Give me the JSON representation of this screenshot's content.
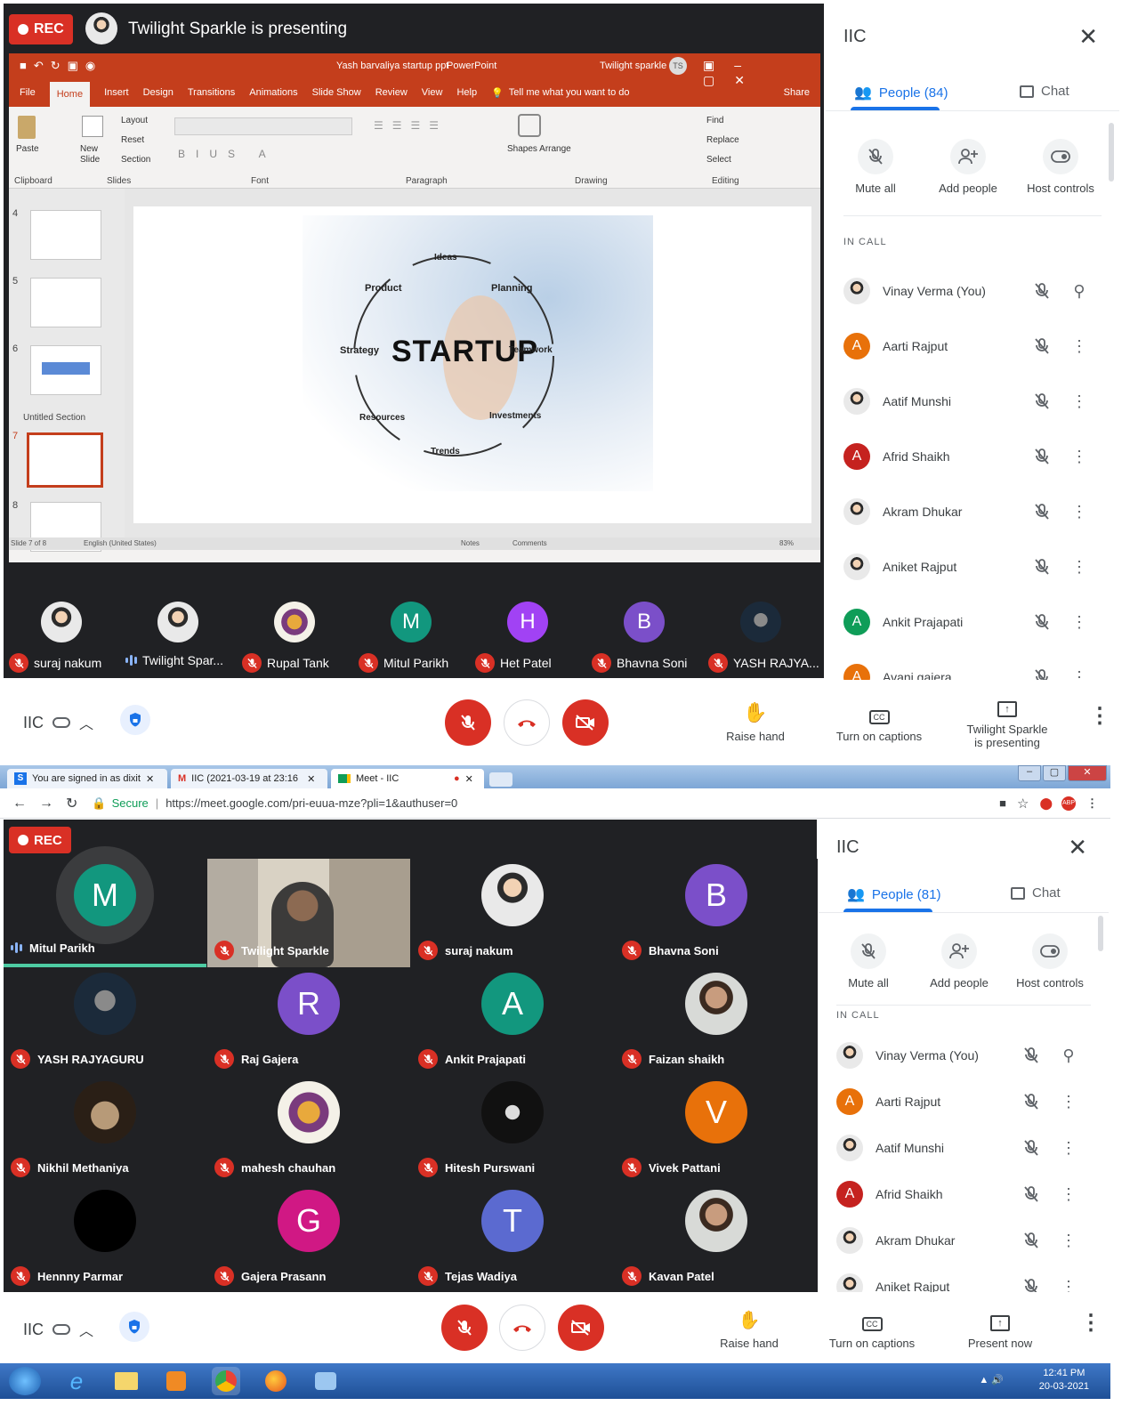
{
  "colors": {
    "accent": "#1a73e8",
    "danger": "#d93025",
    "stage": "#202124"
  },
  "top": {
    "rec": "REC",
    "presenting_banner": "Twilight Sparkle is presenting",
    "ppt": {
      "doc_title": "Yash barvaliya startup ppt",
      "app": "PowerPoint",
      "user": "Twilight sparkle",
      "user_initials": "TS",
      "tabs": [
        "File",
        "Home",
        "Insert",
        "Design",
        "Transitions",
        "Animations",
        "Slide Show",
        "Review",
        "View",
        "Help"
      ],
      "tell_me": "Tell me what you want to do",
      "share": "Share",
      "ribbon": {
        "paste": "Paste",
        "new_slide": "New Slide",
        "layout": "Layout",
        "reset": "Reset",
        "section": "Section",
        "shapes_arrange": "Shapes Arrange",
        "find": "Find",
        "replace": "Replace",
        "select": "Select",
        "groups": [
          "Clipboard",
          "Slides",
          "Font",
          "Paragraph",
          "Drawing",
          "Editing"
        ]
      },
      "thumb_numbers": [
        "4",
        "5",
        "6",
        "7",
        "8"
      ],
      "section_label": "Untitled Section",
      "slide": {
        "center": "STARTUP",
        "words": [
          "Ideas",
          "Planning",
          "Teamwork",
          "Investments",
          "Trends",
          "Resources",
          "Strategy",
          "Product"
        ]
      },
      "status": {
        "slide_of": "Slide 7 of 8",
        "lang": "English (United States)",
        "notes": "Notes",
        "comments": "Comments",
        "zoom": "83%"
      }
    },
    "strip": [
      {
        "name": "suraj nakum",
        "avatar": "photo",
        "mic": "off"
      },
      {
        "name": "Twilight Spar...",
        "avatar": "photo",
        "mic": "on"
      },
      {
        "name": "Rupal Tank",
        "avatar": "god",
        "mic": "off"
      },
      {
        "name": "Mitul Parikh",
        "letter": "M",
        "color": "#12977e",
        "mic": "off"
      },
      {
        "name": "Het Patel",
        "letter": "H",
        "color": "#a142f4",
        "mic": "off"
      },
      {
        "name": "Bhavna Soni",
        "letter": "B",
        "color": "#7b4fc9",
        "mic": "off"
      },
      {
        "name": "YASH RAJYA...",
        "avatar": "dark",
        "mic": "off"
      }
    ],
    "panel": {
      "title": "IIC",
      "people_tab": "People (84)",
      "chat_tab": "Chat",
      "controls": [
        "Mute all",
        "Add people",
        "Host controls"
      ],
      "in_call": "IN CALL",
      "people": [
        {
          "name": "Vinay Verma (You)",
          "avatar": "photo",
          "pin": true
        },
        {
          "name": "Aarti Rajput",
          "letter": "A",
          "color": "#e8710a"
        },
        {
          "name": "Aatif Munshi",
          "avatar": "photo"
        },
        {
          "name": "Afrid Shaikh",
          "letter": "A",
          "color": "#c5221f"
        },
        {
          "name": "Akram Dhukar",
          "avatar": "photo"
        },
        {
          "name": "Aniket Rajput",
          "avatar": "photo"
        },
        {
          "name": "Ankit Prajapati",
          "letter": "A",
          "color": "#0f9d58"
        },
        {
          "name": "Avani gajera",
          "letter": "A",
          "color": "#e8710a"
        }
      ]
    },
    "bottom": {
      "meeting": "IIC",
      "raise_hand": "Raise hand",
      "captions": "Turn on captions",
      "presenting_line1": "Twilight Sparkle",
      "presenting_line2": "is presenting"
    }
  },
  "bottom_shot": {
    "tabs": [
      {
        "title": "You are signed in as dixit",
        "icon": "S"
      },
      {
        "title": "IIC (2021-03-19 at 23:16",
        "icon": "M"
      },
      {
        "title": "Meet - IIC",
        "icon": "meet"
      }
    ],
    "secure": "Secure",
    "url": "https://meet.google.com/pri-euua-mze?pli=1&authuser=0",
    "rec": "REC",
    "grid": [
      {
        "name": "Mitul Parikh",
        "letter": "M",
        "color": "#12977e",
        "mic": "on"
      },
      {
        "name": "Twilight Sparkle",
        "video": true,
        "mic": "off"
      },
      {
        "name": "suraj nakum",
        "avatar": "photo",
        "mic": "off"
      },
      {
        "name": "Bhavna Soni",
        "letter": "B",
        "color": "#7b4fc9",
        "mic": "off"
      },
      {
        "name": "YASH RAJYAGURU",
        "avatar": "dark",
        "mic": "off"
      },
      {
        "name": "Raj Gajera",
        "letter": "R",
        "color": "#7b4fc9",
        "mic": "off"
      },
      {
        "name": "Ankit Prajapati",
        "letter": "A",
        "color": "#12977e",
        "mic": "off"
      },
      {
        "name": "Faizan shaikh",
        "avatar": "guy",
        "mic": "off"
      },
      {
        "name": "Nikhil Methaniya",
        "avatar": "shell",
        "mic": "off"
      },
      {
        "name": "mahesh chauhan",
        "avatar": "god",
        "mic": "off"
      },
      {
        "name": "Hitesh Purswani",
        "avatar": "anon",
        "mic": "off"
      },
      {
        "name": "Vivek Pattani",
        "letter": "V",
        "color": "#e8710a",
        "mic": "off"
      },
      {
        "name": "Hennny Parmar",
        "avatar": "black",
        "mic": "off"
      },
      {
        "name": "Gajera Prasann",
        "letter": "G",
        "color": "#d01884",
        "mic": "off"
      },
      {
        "name": "Tejas Wadiya",
        "letter": "T",
        "color": "#5b6ad0",
        "mic": "off"
      },
      {
        "name": "Kavan Patel",
        "avatar": "guy",
        "mic": "off"
      }
    ],
    "panel": {
      "title": "IIC",
      "people_tab": "People (81)",
      "chat_tab": "Chat",
      "controls": [
        "Mute all",
        "Add people",
        "Host controls"
      ],
      "in_call": "IN CALL",
      "people": [
        {
          "name": "Vinay Verma (You)",
          "avatar": "photo",
          "pin": true
        },
        {
          "name": "Aarti Rajput",
          "letter": "A",
          "color": "#e8710a"
        },
        {
          "name": "Aatif Munshi",
          "avatar": "photo"
        },
        {
          "name": "Afrid Shaikh",
          "letter": "A",
          "color": "#c5221f"
        },
        {
          "name": "Akram Dhukar",
          "avatar": "photo"
        },
        {
          "name": "Aniket Rajput",
          "avatar": "photo"
        }
      ]
    },
    "bottom": {
      "meeting": "IIC",
      "raise_hand": "Raise hand",
      "captions": "Turn on captions",
      "present_now": "Present now"
    },
    "clock": {
      "time": "12:41 PM",
      "date": "20-03-2021"
    }
  }
}
